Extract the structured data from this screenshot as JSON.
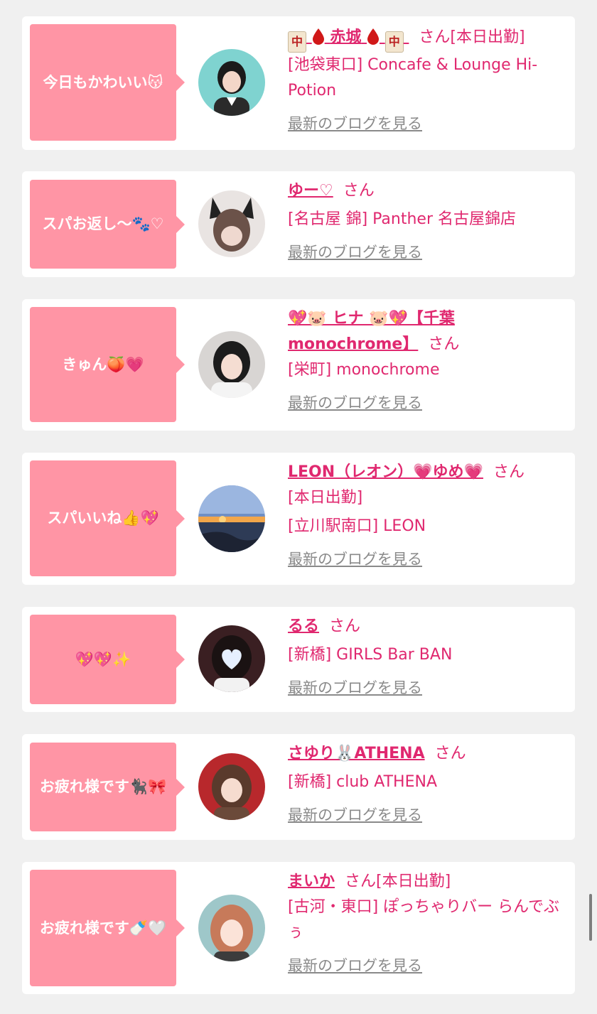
{
  "common": {
    "san_label": "さん",
    "blog_label": "最新のブログを見る"
  },
  "entries": [
    {
      "bubble": "今日もかわいい😽",
      "name": "🀄️🩸赤城🩸🀄️",
      "name_text": "赤城",
      "after_san": "[本日出勤]",
      "status": "",
      "shop": "[池袋東口] Concafe & Lounge Hi-Potion"
    },
    {
      "bubble": "スパお返し〜🐾♡",
      "name": "ゆー♡",
      "after_san": "",
      "status": "",
      "shop": "[名古屋 錦] Panther 名古屋錦店"
    },
    {
      "bubble": "きゅん🍑💗",
      "name": "💖🐷 ヒナ 🐷💖【千葉monochrome】",
      "after_san": "",
      "status": "",
      "shop": "[栄町] monochrome"
    },
    {
      "bubble": "スパいいね👍💖",
      "name": "LEON（レオン）💗ゆめ💗",
      "after_san": "",
      "status": "[本日出勤]",
      "shop": "[立川駅南口] LEON"
    },
    {
      "bubble": "💖💖✨",
      "name": "るる",
      "after_san": "",
      "status": "",
      "shop": "[新橋] GIRLS Bar BAN"
    },
    {
      "bubble": "お疲れ様です🐈‍⬛🎀",
      "name": "さゆり🐰ATHENA",
      "after_san": "",
      "status": "",
      "shop": "[新橋] club ATHENA"
    },
    {
      "bubble": "お疲れ様です🍼🤍",
      "name": "まいか",
      "after_san": "[本日出勤]",
      "status": "",
      "shop": "[古河・東口] ぽっちゃりバー らんでぶぅ"
    }
  ],
  "icons": {
    "mahjong": "mahjong-tile-icon",
    "drop": "blood-drop-icon"
  },
  "colors": {
    "bubble": "#ff95a5",
    "accent": "#e0286f",
    "link_gray": "#8a8a8a",
    "background": "#f0f0f0"
  }
}
